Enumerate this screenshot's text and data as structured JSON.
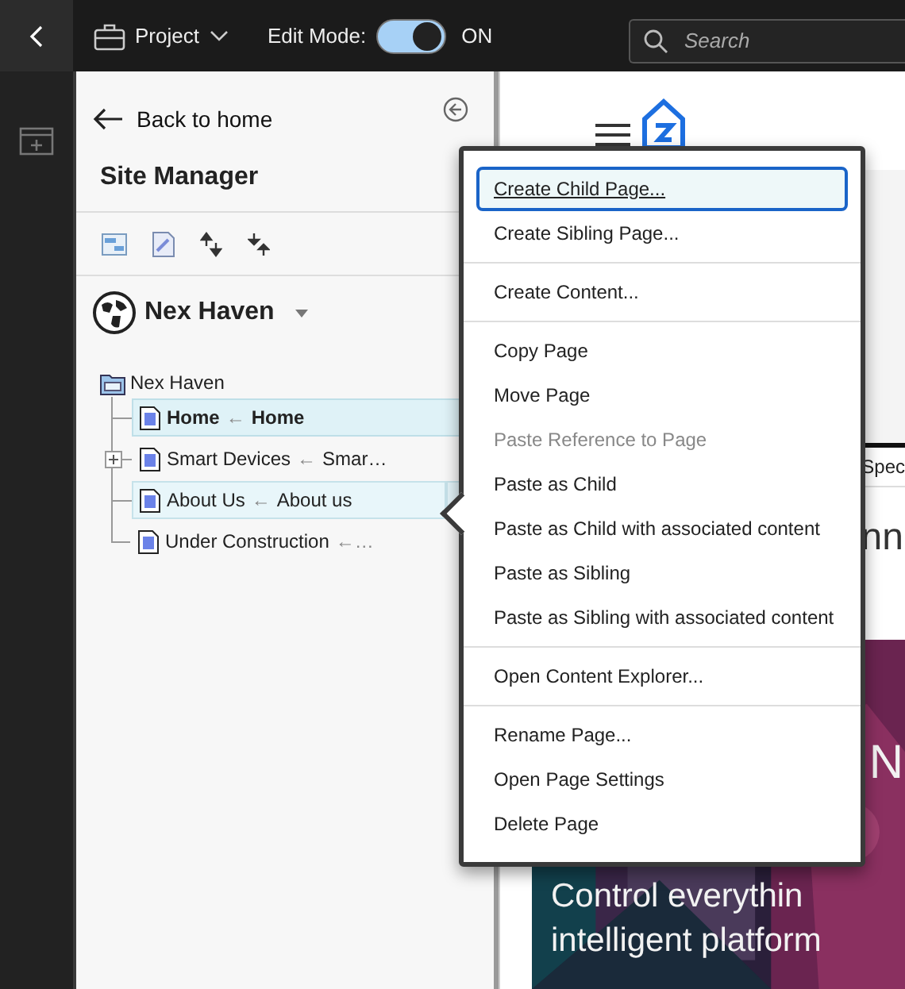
{
  "top_bar": {
    "project": "Project",
    "edit_mode_label": "Edit Mode:",
    "edit_mode": {
      "on": true,
      "text": "ON"
    },
    "search": {
      "placeholder": "Search"
    }
  },
  "panel": {
    "back": "Back to home",
    "title": "Site Manager",
    "site": "Nex Haven"
  },
  "tree": {
    "label": "Nex Haven",
    "children": [
      {
        "title": "Home",
        "arrow": "←",
        "target": "Home",
        "selected": true,
        "collapsed": false,
        "menu_open": false
      },
      {
        "title": "Smart Devices",
        "arrow": "←",
        "target": "Smar…",
        "selected": false,
        "collapsed": true,
        "menu_open": false
      },
      {
        "title": "About Us",
        "arrow": "←",
        "target": "About us",
        "selected": false,
        "collapsed": false,
        "menu_open": true
      },
      {
        "title": "Under Construction",
        "arrow": "←…",
        "selected": false,
        "collapsed": false,
        "menu_open": false
      }
    ]
  },
  "preview": {
    "tab": "Spec",
    "heading": "nn",
    "hero_title": "N",
    "hero_line_1": "Control everythin",
    "hero_line_2": "intelligent platform"
  },
  "context_menu": [
    [
      {
        "label": "Create Child Page...",
        "focused": true,
        "disabled": false
      },
      {
        "label": "Create Sibling Page...",
        "focused": false,
        "disabled": false
      }
    ],
    [
      {
        "label": "Create Content...",
        "focused": false,
        "disabled": false
      }
    ],
    [
      {
        "label": "Copy Page",
        "focused": false,
        "disabled": false
      },
      {
        "label": "Move Page",
        "focused": false,
        "disabled": false
      },
      {
        "label": "Paste Reference to Page",
        "focused": false,
        "disabled": true
      },
      {
        "label": "Paste as Child",
        "focused": false,
        "disabled": false
      },
      {
        "label": "Paste as Child with associated content",
        "focused": false,
        "disabled": false
      },
      {
        "label": "Paste as Sibling",
        "focused": false,
        "disabled": false
      },
      {
        "label": "Paste as Sibling with associated content",
        "focused": false,
        "disabled": false
      }
    ],
    [
      {
        "label": "Open Content Explorer...",
        "focused": false,
        "disabled": false
      }
    ],
    [
      {
        "label": "Rename Page...",
        "focused": false,
        "disabled": false
      },
      {
        "label": "Open Page Settings",
        "focused": false,
        "disabled": false
      },
      {
        "label": "Delete Page",
        "focused": false,
        "disabled": false
      }
    ]
  ]
}
